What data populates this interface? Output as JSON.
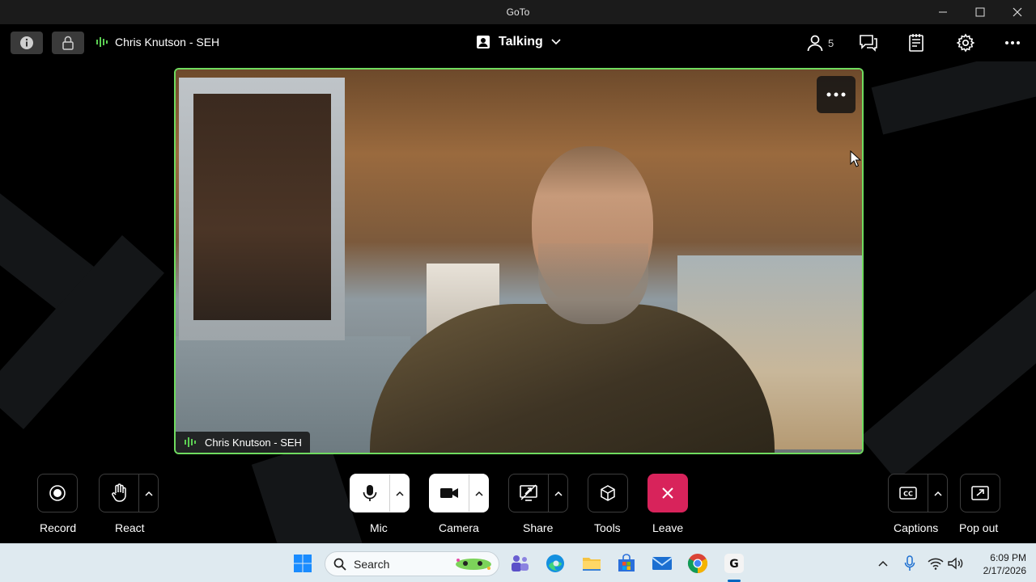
{
  "window": {
    "title": "GoTo"
  },
  "header": {
    "presenter_name": "Chris Knutson - SEH",
    "view_mode": "Talking",
    "participants_count": "5",
    "icons": [
      "info-icon",
      "lock-icon",
      "audio-level-icon",
      "people-icon",
      "chat-icon",
      "notes-icon",
      "settings-icon",
      "more-icon"
    ]
  },
  "video": {
    "participant_name": "Chris Knutson - SEH",
    "border_color": "#6fdb5f"
  },
  "toolbar": {
    "record": "Record",
    "react": "React",
    "mic": "Mic",
    "camera": "Camera",
    "share": "Share",
    "tools": "Tools",
    "leave": "Leave",
    "captions": "Captions",
    "popout": "Pop out",
    "leave_color": "#d8235b"
  },
  "taskbar": {
    "search_placeholder": "Search",
    "time": "6:09 PM",
    "date": "2/17/2026",
    "apps": [
      "windows-start-icon",
      "teams-icon",
      "edge-icon",
      "file-explorer-icon",
      "microsoft-store-icon",
      "mail-icon",
      "chrome-icon",
      "goto-icon"
    ]
  }
}
